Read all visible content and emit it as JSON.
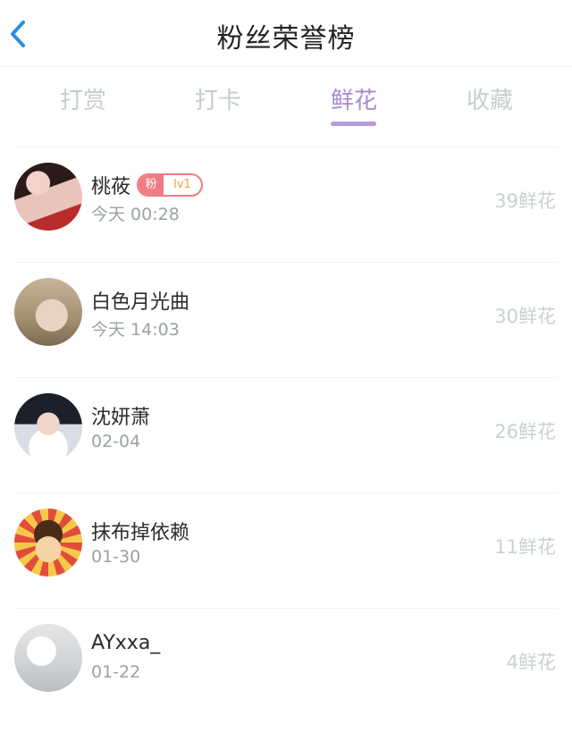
{
  "header": {
    "title": "粉丝荣誉榜",
    "back_icon": "chevron-left-icon"
  },
  "tabs": [
    {
      "label": "打赏",
      "active": false
    },
    {
      "label": "打卡",
      "active": false
    },
    {
      "label": "鲜花",
      "active": true
    },
    {
      "label": "收藏",
      "active": false
    }
  ],
  "list": [
    {
      "name": "桃莜",
      "time": "今天 00:28",
      "score": "39鲜花",
      "badge": {
        "left": "粉",
        "right": "lv1"
      }
    },
    {
      "name": "白色月光曲",
      "time": "今天 14:03",
      "score": "30鲜花"
    },
    {
      "name": "沈妍萧",
      "time": "02-04",
      "score": "26鲜花"
    },
    {
      "name": "抹布掉依赖",
      "time": "01-30",
      "score": "11鲜花"
    },
    {
      "name": "AYxxa_",
      "time": "01-22",
      "score": "4鲜花"
    }
  ],
  "colors": {
    "accent": "#b79ae0",
    "badge": "#f07b84",
    "muted": "#c9d2cd"
  }
}
